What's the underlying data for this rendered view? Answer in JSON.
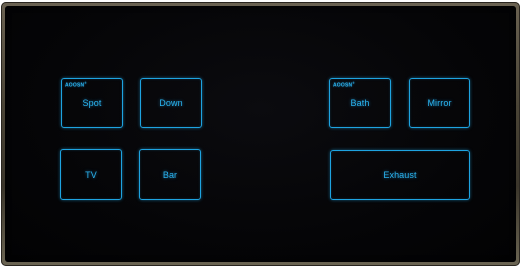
{
  "accent_color": "#1ea3e0",
  "panel_color": "#050507",
  "frame_color": "#4a4436",
  "left_group": {
    "brand": "AOOSN",
    "buttons": [
      "Spot",
      "Down",
      "TV",
      "Bar"
    ]
  },
  "right_group": {
    "brand": "AOOSN",
    "buttons": [
      "Bath",
      "Mirror",
      "Exhaust"
    ]
  }
}
